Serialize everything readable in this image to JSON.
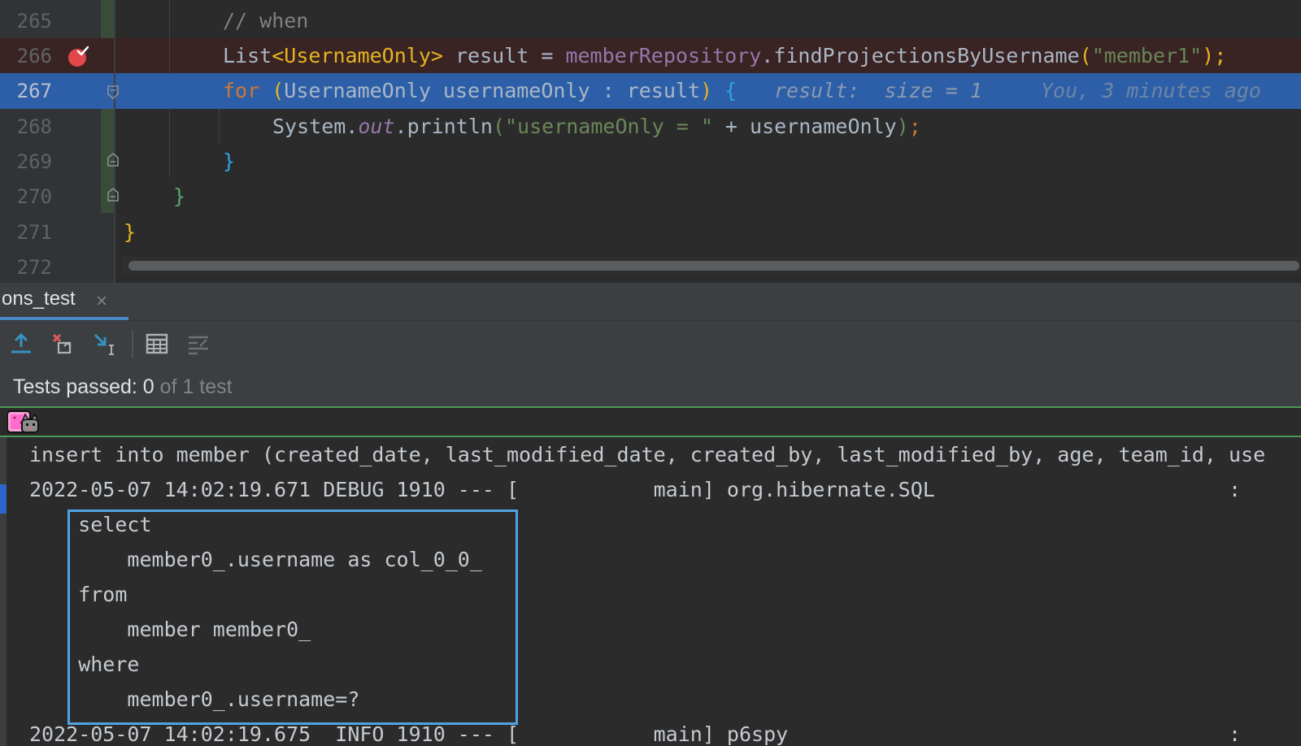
{
  "editor": {
    "lines": [
      {
        "num": "265",
        "comment": "// when"
      },
      {
        "num": "266",
        "t1": "List",
        "t2": "<UsernameOnly>",
        "t3": " result = ",
        "t4": "memberRepository",
        "t5": ".findProjectionsByUsername",
        "t6": "(",
        "t7": "\"member1\"",
        "t8": ");"
      },
      {
        "num": "267",
        "kw": "for",
        "p1": " (",
        "t1": "UsernameOnly usernameOnly : result",
        "p2": ")",
        "b": " {",
        "hint": "result:  size = 1",
        "blame": "You, 3 minutes ago"
      },
      {
        "num": "268",
        "t1": "System.",
        "t2": "out",
        "t3": ".println",
        "t4": "(",
        "t5": "\"usernameOnly = \"",
        "t6": " + usernameOnly",
        "t7": ")",
        "t8": ";"
      },
      {
        "num": "269",
        "brace": "}"
      },
      {
        "num": "270",
        "brace": "}"
      },
      {
        "num": "271",
        "brace": "}"
      },
      {
        "num": "272"
      }
    ]
  },
  "toolwindow": {
    "tab_label": "ons_test",
    "tab_close": "×",
    "toolbar_icons": [
      "export-icon",
      "stop-rerun-icon",
      "import-icon",
      "table-icon",
      "settings-list-icon"
    ],
    "status_main": "Tests passed: 0",
    "status_muted": " of 1 test"
  },
  "console": {
    "lines": [
      "insert into member (created_date, last_modified_date, created_by, last_modified_by, age, team_id, use",
      "2022-05-07 14:02:19.671 DEBUG 1910 --- [           main] org.hibernate.SQL                        :",
      "    select",
      "        member0_.username as col_0_0_",
      "    from",
      "        member member0_",
      "    where",
      "        member0_.username=?",
      "2022-05-07 14:02:19.675  INFO 1910 --- [           main] p6spy                                    : "
    ]
  },
  "colors": {
    "breakpoint_line": "#3a2323",
    "execution_line": "#2d5fa8",
    "tests_progress": "#499c54",
    "highlight_box": "#4fa3e0"
  }
}
